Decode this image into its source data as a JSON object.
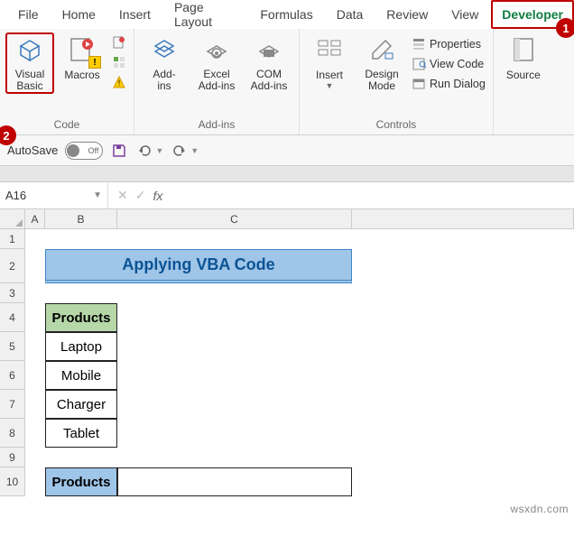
{
  "tabs": {
    "file": "File",
    "home": "Home",
    "insert": "Insert",
    "pagelayout": "Page Layout",
    "formulas": "Formulas",
    "data": "Data",
    "review": "Review",
    "view": "View",
    "developer": "Developer"
  },
  "ribbon": {
    "code": {
      "vb": "Visual\nBasic",
      "macros": "Macros",
      "label": "Code"
    },
    "addins": {
      "addins": "Add-\nins",
      "excel": "Excel\nAdd-ins",
      "com": "COM\nAdd-ins",
      "label": "Add-ins"
    },
    "controls": {
      "insert": "Insert",
      "design": "Design\nMode",
      "props": "Properties",
      "viewcode": "View Code",
      "rundlg": "Run Dialog",
      "label": "Controls"
    },
    "xml": {
      "source": "Source"
    }
  },
  "qat": {
    "autosave": "AutoSave",
    "toggle": "Off"
  },
  "namebox": "A16",
  "sheet": {
    "title": "Applying VBA Code",
    "header": "Products",
    "products": [
      "Laptop",
      "Mobile",
      "Charger",
      "Tablet"
    ],
    "header2": "Products"
  },
  "cols": [
    "A",
    "B",
    "C"
  ],
  "rows": [
    "1",
    "2",
    "3",
    "4",
    "5",
    "6",
    "7",
    "8",
    "9",
    "10"
  ],
  "callouts": {
    "one": "1",
    "two": "2"
  },
  "watermark": "wsxdn.com"
}
